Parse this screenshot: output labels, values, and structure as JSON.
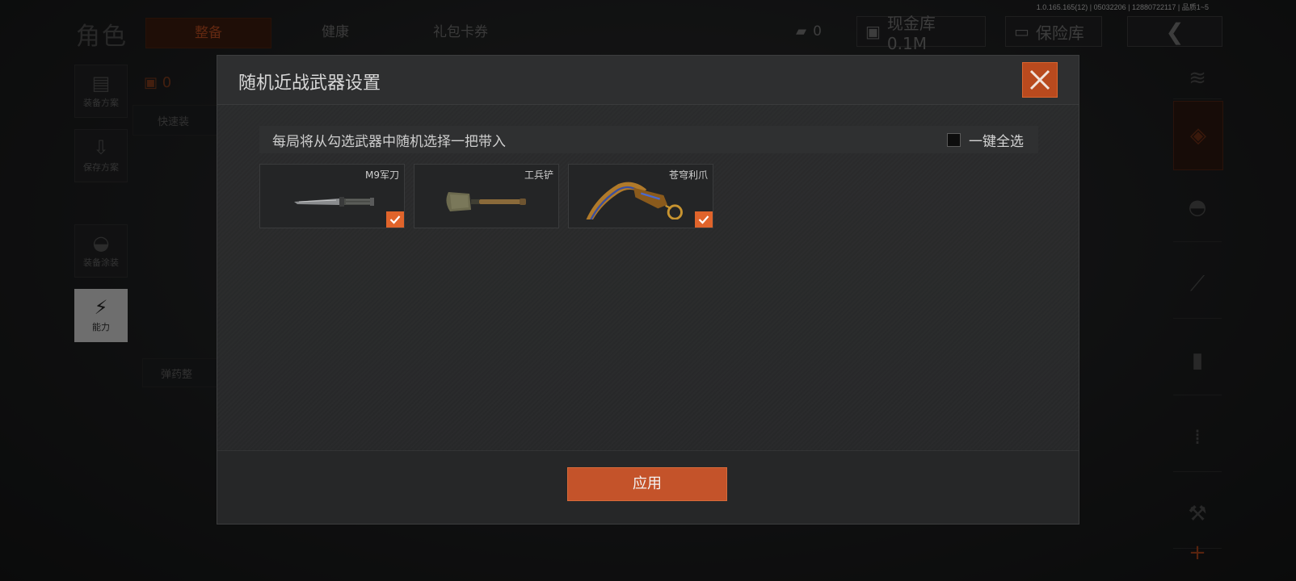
{
  "version": "1.0.165.165(12) | 05032206 | 12880722117 | 品质1~5",
  "top": {
    "title": "角色",
    "tabs": {
      "equip": "整备",
      "health": "健康",
      "gift": "礼包卡券"
    },
    "money_value": "0",
    "cash_label": "现金库 0.1M",
    "safe_label": "保险库"
  },
  "left_sidebar": {
    "loadout": "装备方案",
    "save": "保存方案",
    "skin": "装备涂装",
    "ability": "能力"
  },
  "behind": {
    "backpack_count": "0",
    "quick_equip": "快速装",
    "ammo": "弹药整"
  },
  "dialog": {
    "title": "随机近战武器设置",
    "instruction": "每局将从勾选武器中随机选择一把带入",
    "select_all_label": "一键全选",
    "select_all_checked": false,
    "weapons": [
      {
        "name": "M9军刀",
        "icon": "bayonet-knife",
        "checked": true
      },
      {
        "name": "工兵铲",
        "icon": "entrenching-shovel",
        "checked": false
      },
      {
        "name": "苍穹利爪",
        "icon": "karambit-claw",
        "checked": true
      }
    ],
    "apply_label": "应用"
  },
  "colors": {
    "accent": "#c4532a",
    "check": "#e0642b",
    "dialog_bg": "#2a2b2c"
  }
}
